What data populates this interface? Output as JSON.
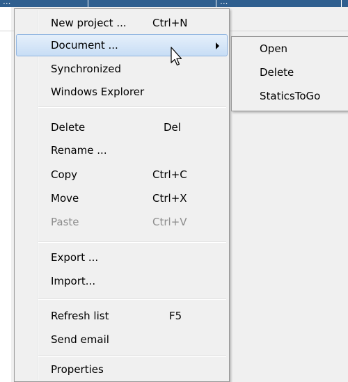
{
  "background": {
    "title_fragment_left": "...",
    "title_fragment_right": "..."
  },
  "context_menu": {
    "items": [
      {
        "label": "New project ...",
        "shortcut": "Ctrl+N",
        "state": "normal"
      },
      {
        "label": "Document ...",
        "shortcut": "",
        "state": "highlighted",
        "has_submenu": true
      },
      {
        "label": "Synchronized",
        "shortcut": "",
        "state": "normal"
      },
      {
        "label": "Windows Explorer",
        "shortcut": "",
        "state": "normal"
      },
      {
        "label": "Delete",
        "shortcut": "Del",
        "state": "normal"
      },
      {
        "label": "Rename ...",
        "shortcut": "",
        "state": "normal"
      },
      {
        "label": "Copy",
        "shortcut": "Ctrl+C",
        "state": "normal"
      },
      {
        "label": "Move",
        "shortcut": "Ctrl+X",
        "state": "normal"
      },
      {
        "label": "Paste",
        "shortcut": "Ctrl+V",
        "state": "disabled"
      },
      {
        "label": "Export ...",
        "shortcut": "",
        "state": "normal"
      },
      {
        "label": "Import...",
        "shortcut": "",
        "state": "normal"
      },
      {
        "label": "Refresh list",
        "shortcut": "F5",
        "state": "normal"
      },
      {
        "label": "Send email",
        "shortcut": "",
        "state": "normal"
      },
      {
        "label": "Properties",
        "shortcut": "",
        "state": "normal"
      }
    ]
  },
  "submenu": {
    "items": [
      {
        "label": "Open"
      },
      {
        "label": "Delete"
      },
      {
        "label": "StaticsToGo"
      }
    ]
  },
  "colors": {
    "highlight": "#c7ddf5",
    "highlight_border": "#8fb4e0",
    "disabled_text": "#8d8d8d",
    "menu_background": "#f0f0f0",
    "title_strip": "#2f5f8f"
  },
  "icons": {
    "submenu_arrow": "chevron-right-icon",
    "cursor": "mouse-cursor-icon"
  }
}
